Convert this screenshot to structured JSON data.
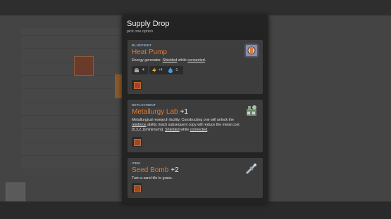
{
  "modal": {
    "title": "Supply Drop",
    "subtitle": "pick one option"
  },
  "cards": [
    {
      "tag": "BLUEPRINT",
      "title": "Heat Pump",
      "plus": "",
      "desc_parts": [
        "Energy generator. ",
        "Shielded",
        " while ",
        "connected",
        "."
      ],
      "stats": [
        "4",
        "+4",
        "-1"
      ],
      "icon": "heat-pump-icon",
      "title_color": "#e07a34"
    },
    {
      "tag": "DEPLOYMENT",
      "title": "Metallurgy Lab",
      "plus": "+1",
      "desc_parts": [
        "Metallurgical research facility. Constructing one will unlock the ",
        "reinforce",
        " ability. Each subsequent copy will reduce the metal cost [5,3,2,1(minimum)]. ",
        "Shielded",
        " while ",
        "connected",
        "."
      ],
      "icon": "metallurgy-lab-icon"
    },
    {
      "tag": "ITEM",
      "title": "Seed Bomb",
      "plus": "+2",
      "desc": "Turn a sand tile to grass.",
      "icon": "seed-bomb-icon"
    }
  ],
  "colors": {
    "accent": "#e07a34",
    "tag": "#8fb4d8",
    "panel": "#232323",
    "card": "#3d3d3d"
  }
}
